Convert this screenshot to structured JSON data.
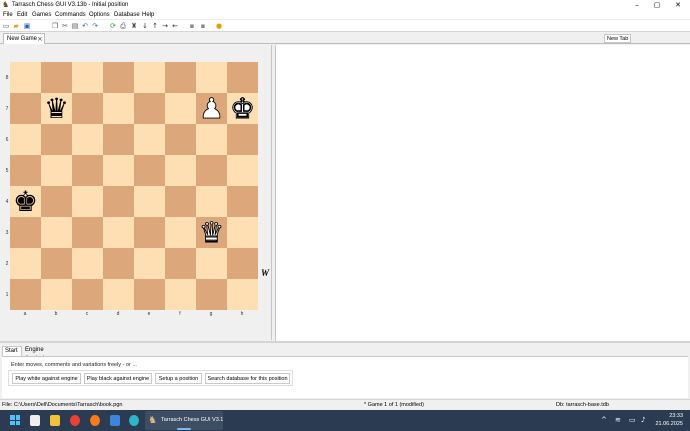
{
  "window": {
    "title": "Tarrasch Chess GUI V3.13b  -  Initial position",
    "app_icon": "chess-knight-icon",
    "controls": [
      "minimize-icon",
      "maximize-icon",
      "close-icon"
    ]
  },
  "menu": [
    "File",
    "Edit",
    "Games",
    "Commands",
    "Options",
    "Database",
    "Help"
  ],
  "toolbar": {
    "icons": [
      "new-file-icon",
      "open-file-icon",
      "save-icon",
      "copy-icon",
      "cut-icon",
      "paste-icon",
      "undo-icon",
      "redo-icon",
      "flip-board-icon",
      "print-icon",
      "engine-icon",
      "move-down-icon",
      "move-up-icon",
      "forward-icon",
      "back-icon",
      "first-move-icon",
      "last-move-icon",
      "help-icon"
    ]
  },
  "tabs": {
    "document_tab": "New Game",
    "new_tab_button": "New Tab"
  },
  "board": {
    "files": [
      "a",
      "b",
      "c",
      "d",
      "e",
      "f",
      "g",
      "h"
    ],
    "ranks": [
      "8",
      "7",
      "6",
      "5",
      "4",
      "3",
      "2",
      "1"
    ],
    "side_to_move": "W",
    "colors": {
      "light": "#fedfb3",
      "dark": "#dca87b"
    },
    "pieces": [
      {
        "square": "b7",
        "piece": "queen",
        "color": "black"
      },
      {
        "square": "g7",
        "piece": "pawn",
        "color": "white"
      },
      {
        "square": "h7",
        "piece": "king",
        "color": "white"
      },
      {
        "square": "a4",
        "piece": "king",
        "color": "black"
      },
      {
        "square": "g3",
        "piece": "queen",
        "color": "white"
      }
    ]
  },
  "bottom": {
    "tabs": [
      "Start",
      "Engine Analysis"
    ],
    "hint": "Enter moves, comments and variations freely - or ...",
    "buttons": [
      "Play white against engine",
      "Play black against engine",
      "Setup a position",
      "Search database for this position"
    ]
  },
  "status": {
    "file": "File: C:\\Users\\Dell\\Documents\\Tarrasch\\book.pgn",
    "game": "* Game 1 of 1 (modified)",
    "db": "Db: tarrasch-base.tdb"
  },
  "taskbar": {
    "app_label": "Tarrasch Chess GUI V3.1",
    "time": "23:33",
    "date": "21.06.2025",
    "pinned": [
      "windows-start-icon",
      "file-explorer-icon",
      "folder-icon",
      "chrome-icon",
      "firefox-icon",
      "notepad-icon",
      "edge-icon"
    ],
    "tray": [
      "chevron-up-icon",
      "wifi-icon",
      "display-icon",
      "speaker-icon"
    ]
  }
}
